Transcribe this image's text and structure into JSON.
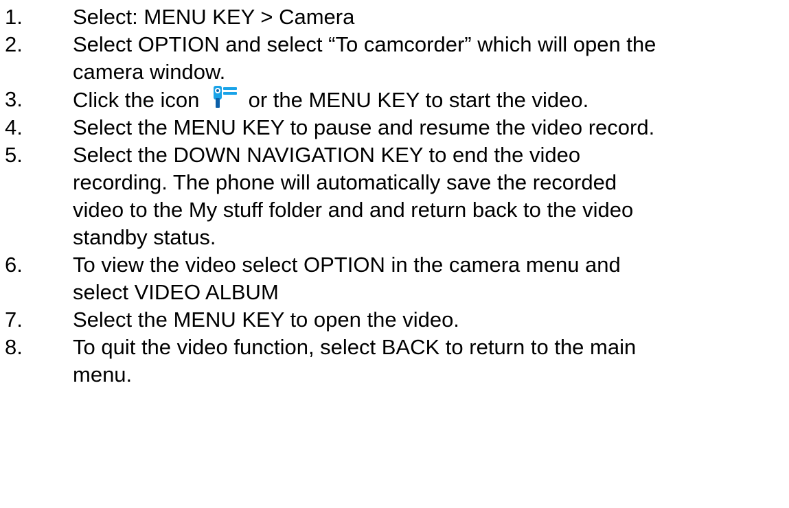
{
  "steps": [
    {
      "number": "1.",
      "lines": [
        "Select: MENU KEY > Camera"
      ]
    },
    {
      "number": "2.",
      "lines": [
        "Select OPTION and select “To camcorder” which will open the",
        "camera window."
      ]
    },
    {
      "number": "3.",
      "before_icon": "Click the icon",
      "icon": "camcorder-icon",
      "after_icon": "or the MENU KEY to start the video."
    },
    {
      "number": "4.",
      "lines": [
        "Select the MENU KEY to pause and resume the video record."
      ]
    },
    {
      "number": "5.",
      "lines": [
        "Select the DOWN NAVIGATION KEY to end the video",
        "recording. The phone will automatically save the recorded",
        "video to the My stuff folder and and return back to the video",
        "standby status."
      ]
    },
    {
      "number": "6.",
      "lines": [
        "To view the video select OPTION in the camera menu and",
        "select VIDEO ALBUM"
      ]
    },
    {
      "number": "7.",
      "lines": [
        "Select the MENU KEY to open the video."
      ]
    },
    {
      "number": "8.",
      "lines": [
        "To quit the video function, select BACK to return to the main",
        "menu."
      ]
    }
  ],
  "colors": {
    "text": "#000000",
    "icon_blue": "#1aa3e8",
    "icon_dark": "#0b5fa8"
  }
}
